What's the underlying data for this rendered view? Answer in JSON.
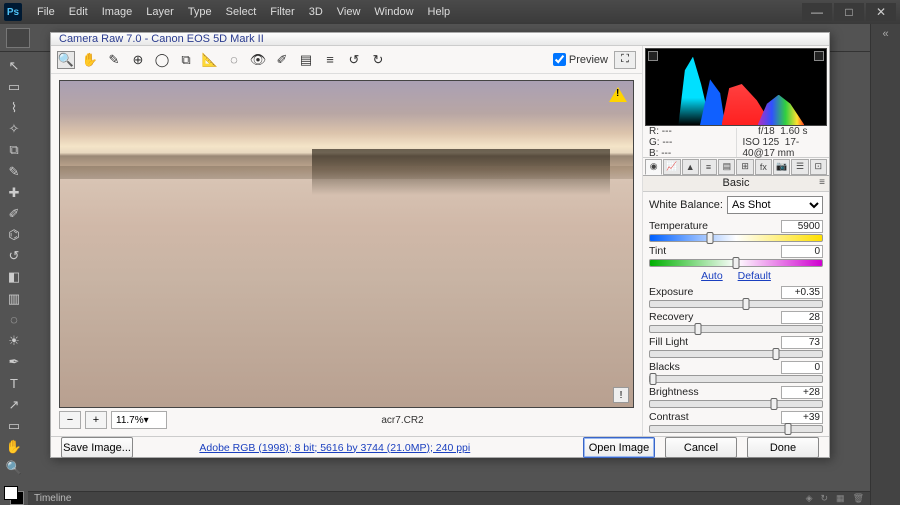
{
  "app": {
    "menus": [
      "File",
      "Edit",
      "Image",
      "Layer",
      "Type",
      "Select",
      "Filter",
      "3D",
      "View",
      "Window",
      "Help"
    ]
  },
  "dialog": {
    "title": "Camera Raw 7.0  -  Canon EOS 5D Mark II",
    "preview_label": "Preview",
    "filename": "acr7.CR2",
    "zoom": "11.7%",
    "save_image": "Save Image...",
    "workflow_link": "Adobe RGB (1998); 8 bit; 5616 by 3744 (21.0MP); 240 ppi",
    "open": "Open Image",
    "cancel": "Cancel",
    "done": "Done"
  },
  "meta": {
    "r": "R: ---",
    "g": "G: ---",
    "b": "B: ---",
    "aperture": "f/18",
    "shutter": "1.60 s",
    "iso": "ISO 125",
    "lens": "17-40@17 mm"
  },
  "panel": {
    "title": "Basic",
    "wb_label": "White Balance:",
    "wb_value": "As Shot",
    "auto": "Auto",
    "default": "Default"
  },
  "sliders": {
    "temperature": {
      "label": "Temperature",
      "value": "5900",
      "pos": 35
    },
    "tint": {
      "label": "Tint",
      "value": "0",
      "pos": 50
    },
    "exposure": {
      "label": "Exposure",
      "value": "+0.35",
      "pos": 56
    },
    "recovery": {
      "label": "Recovery",
      "value": "28",
      "pos": 28
    },
    "filllight": {
      "label": "Fill Light",
      "value": "73",
      "pos": 73
    },
    "blacks": {
      "label": "Blacks",
      "value": "0",
      "pos": 2
    },
    "brightness": {
      "label": "Brightness",
      "value": "+28",
      "pos": 72
    },
    "contrast": {
      "label": "Contrast",
      "value": "+39",
      "pos": 80
    }
  },
  "timeline": {
    "label": "Timeline"
  }
}
